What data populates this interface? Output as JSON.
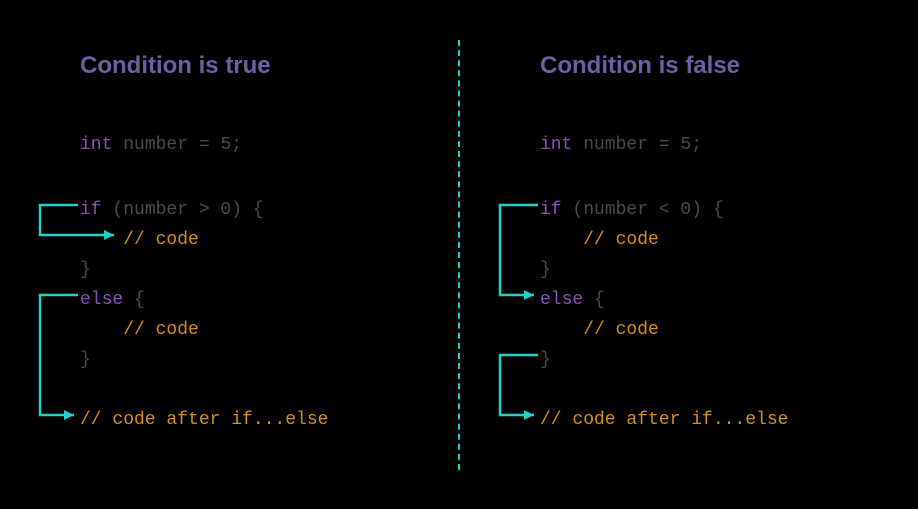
{
  "divider": {
    "color": "#1fd1c7",
    "style": "dashed"
  },
  "colors": {
    "title": "#6563a2",
    "keyword": "#8a4fbf",
    "dim": "#4a4a4a",
    "comment": "#d98c1a",
    "arrow": "#1fd1c7",
    "background": "#000000"
  },
  "left": {
    "title": "Condition is true",
    "decl_type": "int",
    "decl_ident": " number ",
    "decl_assign": "= ",
    "decl_value": "5",
    "decl_semi": ";",
    "if_kw": "if",
    "if_cond": " (number > 0) {",
    "if_body": "    // code",
    "if_close": "}",
    "else_kw": "else",
    "else_open": " {",
    "else_body": "    // code",
    "else_close": "}",
    "after": "// code after if...else",
    "flow_description": "Condition true: enter if, then continue after if...else (skip else)"
  },
  "right": {
    "title": "Condition is false",
    "decl_type": "int",
    "decl_ident": " number ",
    "decl_assign": "= ",
    "decl_value": "5",
    "decl_semi": ";",
    "if_kw": "if",
    "if_cond": " (number < 0) {",
    "if_body": "    // code",
    "if_close": "}",
    "else_kw": "else",
    "else_open": " {",
    "else_body": "    // code",
    "else_close": "}",
    "after": "// code after if...else",
    "flow_description": "Condition false: skip if body, enter else, then continue after if...else"
  }
}
